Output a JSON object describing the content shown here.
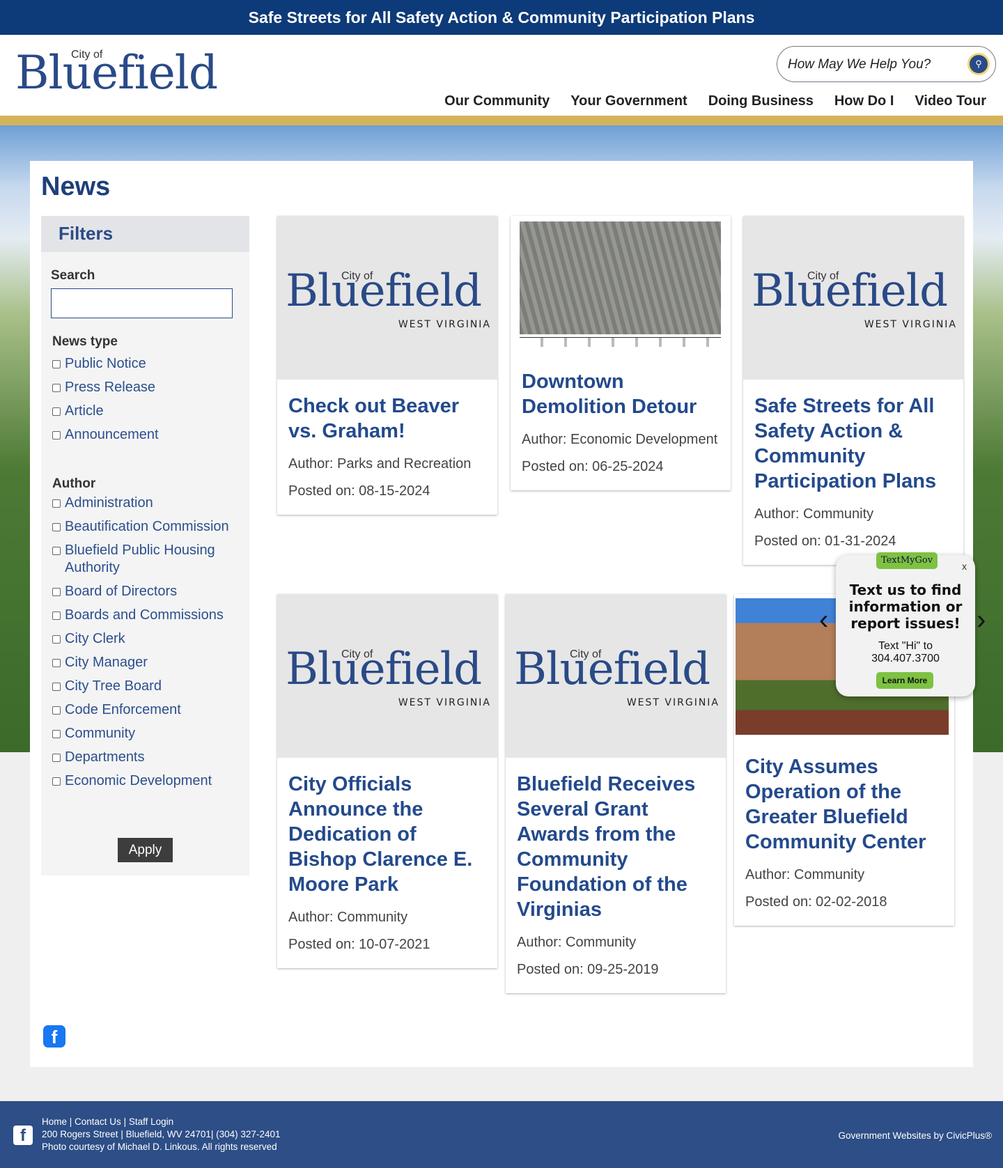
{
  "banner": "Safe Streets for All Safety Action & Community Participation Plans",
  "logo": {
    "city_of": "City of",
    "name": "Bluefield",
    "state": "WEST VIRGINIA"
  },
  "search": {
    "placeholder": "How May We Help You?",
    "icon": "search-icon"
  },
  "nav": [
    "Our Community",
    "Your Government",
    "Doing Business",
    "How Do I",
    "Video Tour"
  ],
  "page_title": "News",
  "filters": {
    "heading": "Filters",
    "search_label": "Search",
    "search_value": "",
    "news_type_label": "News type",
    "news_types": [
      "Public Notice",
      "Press Release",
      "Article",
      "Announcement"
    ],
    "author_label": "Author",
    "authors": [
      "Administration",
      "Beautification Commission",
      "Bluefield Public Housing Authority",
      "Board of Directors",
      "Boards and Commissions",
      "City Clerk",
      "City Manager",
      "City Tree Board",
      "Code Enforcement",
      "Community",
      "Departments",
      "Economic Development"
    ],
    "apply_label": "Apply"
  },
  "news": [
    {
      "title": "Check out Beaver vs. Graham!",
      "author": "Author: Parks and Recreation",
      "posted": "Posted on: 08-15-2024",
      "image": "logo"
    },
    {
      "title": "Downtown Demolition Detour",
      "author": "Author: Economic Development",
      "posted": "Posted on: 06-25-2024",
      "image": "aerial-map"
    },
    {
      "title": "Safe Streets for All Safety Action & Community Participation Plans",
      "author": "Author: Community",
      "posted": "Posted on: 01-31-2024",
      "image": "logo"
    },
    {
      "title": "City Officials Announce the Dedication of Bishop Clarence E. Moore Park",
      "author": "Author: Community",
      "posted": "Posted on: 10-07-2021",
      "image": "logo"
    },
    {
      "title": "Bluefield Receives Several Grant Awards from the Community Foundation of the Virginias",
      "author": "Author: Community",
      "posted": "Posted on: 09-25-2019",
      "image": "logo"
    },
    {
      "title": "City Assumes Operation of the Greater Bluefield Community Center",
      "author": "Author: Community",
      "posted": "Posted on: 02-02-2018",
      "image": "building-photo"
    }
  ],
  "popup": {
    "brand": "TextMyGov",
    "heading": "Text us to find information or report issues!",
    "line1": "Text \"Hi\" to",
    "line2": "304.407.3700",
    "button": "Learn More",
    "close": "x"
  },
  "footer": {
    "links": [
      "Home",
      "Contact Us",
      "Staff Login"
    ],
    "address": "200 Rogers Street | Bluefield, WV 24701| (304) 327-2401",
    "credit": "Photo courtesy of Michael D. Linkous. All rights reserved",
    "vendor": "Government Websites by CivicPlus®"
  },
  "colors": {
    "banner": "#0d3a78",
    "brand_blue": "#2a4a87",
    "gold": "#d3b45c",
    "footer": "#2d4e86",
    "textmygov_green": "#7dc242"
  }
}
